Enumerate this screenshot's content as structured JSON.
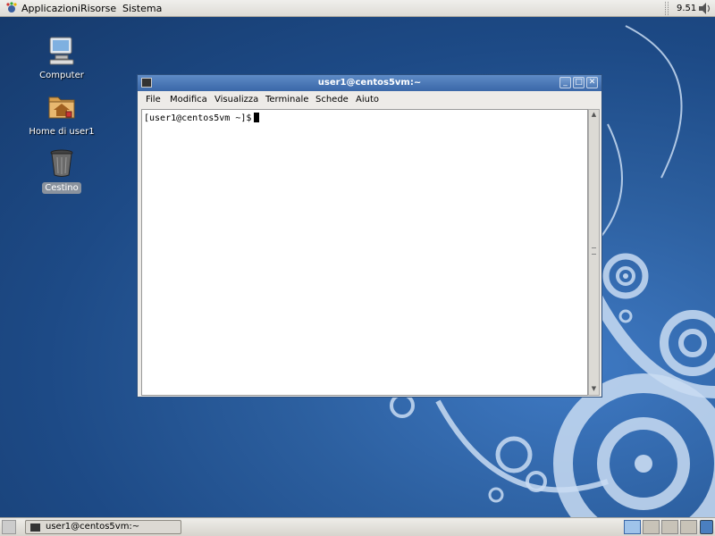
{
  "top_panel": {
    "menus": [
      "Applicazioni",
      "Risorse",
      "Sistema"
    ],
    "clock": "9.51",
    "icons": [
      "gnome-foot-icon",
      "volume-icon"
    ]
  },
  "desktop": {
    "icons": [
      {
        "label": "Computer",
        "icon": "computer-icon"
      },
      {
        "label": "Home di user1",
        "icon": "home-folder-icon"
      },
      {
        "label": "Cestino",
        "icon": "trash-icon",
        "selected": true
      }
    ]
  },
  "terminal": {
    "title": "user1@centos5vm:~",
    "menus": [
      "File",
      "Modifica",
      "Visualizza",
      "Terminale",
      "Schede",
      "Aiuto"
    ],
    "prompt": "[user1@centos5vm ~]$",
    "buttons": [
      "minimize-button",
      "maximize-button",
      "close-button"
    ]
  },
  "bottom_panel": {
    "task_label": "user1@centos5vm:~",
    "workspaces": 4,
    "active_workspace": 1
  },
  "colors": {
    "titlebar": "#4a78b8",
    "desktop": "#1d4a86",
    "panel": "#e6e4df"
  }
}
